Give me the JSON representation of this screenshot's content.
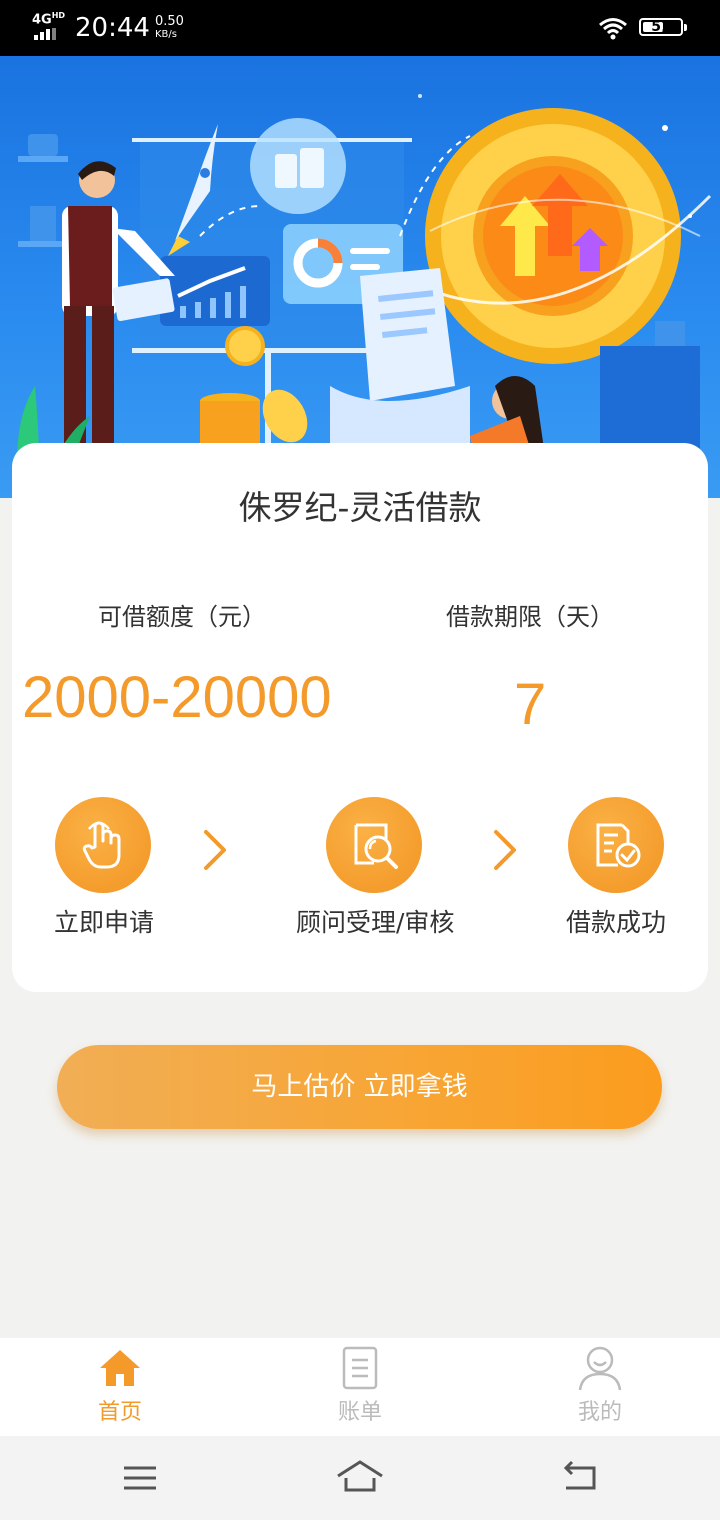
{
  "status_bar": {
    "network": "4G",
    "network_sup": "HD",
    "time": "20:44",
    "speed_value": "0.50",
    "speed_unit": "KB/s",
    "battery": "51"
  },
  "card": {
    "title": "侏罗纪-灵活借款",
    "amount_label": "可借额度（元）",
    "amount_value": "2000-20000",
    "term_label": "借款期限（天）",
    "term_value": "7",
    "steps": [
      {
        "label": "立即申请",
        "icon": "hand-tap-icon"
      },
      {
        "label": "顾问受理/审核",
        "icon": "search-document-icon"
      },
      {
        "label": "借款成功",
        "icon": "approved-document-icon"
      }
    ]
  },
  "cta": {
    "label": "马上估价  立即拿钱"
  },
  "tabbar": {
    "items": [
      {
        "label": "首页",
        "icon": "home-icon",
        "active": true
      },
      {
        "label": "账单",
        "icon": "bill-icon",
        "active": false
      },
      {
        "label": "我的",
        "icon": "user-icon",
        "active": false
      }
    ]
  },
  "colors": {
    "accent": "#f39a2a",
    "banner_blue": "#1a73e0",
    "inactive_tab": "#bbbbbb",
    "text": "#333333"
  }
}
